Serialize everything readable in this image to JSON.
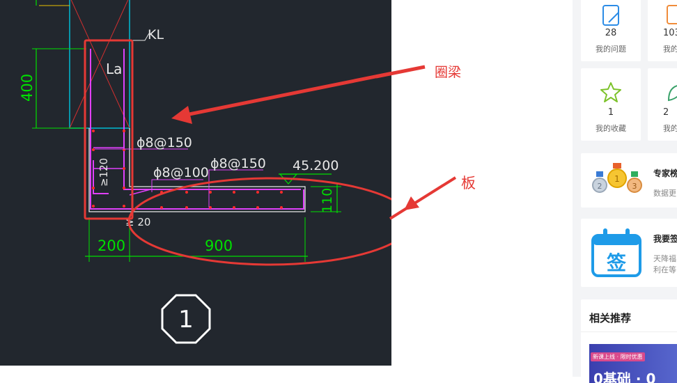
{
  "cad": {
    "label_kl": "KL",
    "label_la": "La",
    "dim_400": "400",
    "rebar_1": "ϕ8@150",
    "rebar_2": "ϕ8@100",
    "rebar_3": "ϕ8@150",
    "dim_120": "≥120",
    "dim_20": "≥ 20",
    "elevation": "45.200",
    "dim_110": "110",
    "dim_200": "200",
    "dim_900": "900",
    "section_no": "1"
  },
  "annotations": {
    "ring_beam": "圈梁",
    "slab": "板"
  },
  "sidebar": {
    "stats": [
      {
        "count": "28",
        "label": "我的问题"
      },
      {
        "count": "103",
        "label": "我的"
      },
      {
        "count": "1",
        "label": "我的收藏"
      },
      {
        "count": "2",
        "label": "我的"
      }
    ],
    "expert_card": {
      "title": "专家榜",
      "desc": "数据更"
    },
    "signin_card": {
      "title": "我要签",
      "desc_line1": "天降福",
      "desc_line2": "利在等",
      "icon_char": "签"
    },
    "recommend": {
      "title": "相关推荐",
      "banner_tag": "新课上线 · 限时优惠",
      "banner_text": "0基础 · 0"
    }
  },
  "colors": {
    "cad_bg": "#22272e",
    "beam_outline": "#00bcd4",
    "rebar": "#e040fb",
    "dim_line": "#00e000",
    "markup_red": "#e53935"
  }
}
